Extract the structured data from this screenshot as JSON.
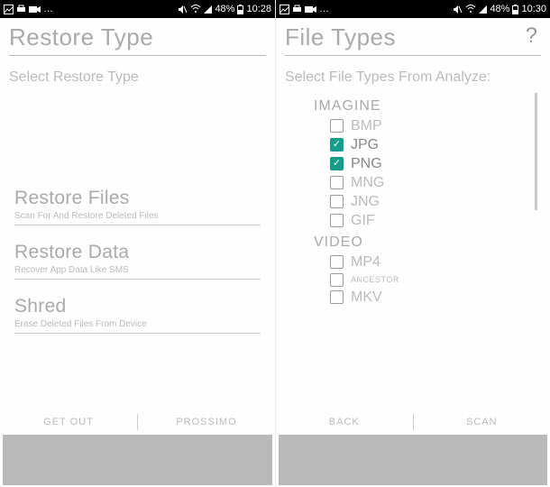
{
  "status_icons": {
    "mute": "mute-icon",
    "wifi": "wifi-icon",
    "signal": "signal-icon"
  },
  "left": {
    "statusbar": {
      "battery_pct": "48%",
      "time": "10:28"
    },
    "title": "Restore Type",
    "subtitle": "Select Restore Type",
    "options": [
      {
        "title": "Restore Files",
        "desc": "Scan For And Restore Deleted Files"
      },
      {
        "title": "Restore Data",
        "desc": "Recover App Data Like SMS"
      },
      {
        "title": "Shred",
        "desc": "Erase Deleted Files From Device"
      }
    ],
    "buttons": {
      "left": "GET OUT",
      "right": "PROSSIMO"
    }
  },
  "right": {
    "statusbar": {
      "battery_pct": "48%",
      "time": "10:30"
    },
    "title": "File Types",
    "help": "?",
    "subtitle": "Select File Types From Analyze:",
    "groups": [
      {
        "label": "IMAGINE",
        "items": [
          {
            "label": "BMP",
            "checked": false
          },
          {
            "label": "JPG",
            "checked": true
          },
          {
            "label": "PNG",
            "checked": true
          },
          {
            "label": "MNG",
            "checked": false
          },
          {
            "label": "JNG",
            "checked": false
          },
          {
            "label": "GIF",
            "checked": false
          }
        ]
      },
      {
        "label": "VIDEO",
        "items": [
          {
            "label": "MP4",
            "checked": false
          },
          {
            "label": "ANCESTOR",
            "checked": false,
            "small": true
          },
          {
            "label": "MKV",
            "checked": false
          }
        ]
      }
    ],
    "buttons": {
      "left": "BACK",
      "right": "SCAN"
    }
  }
}
